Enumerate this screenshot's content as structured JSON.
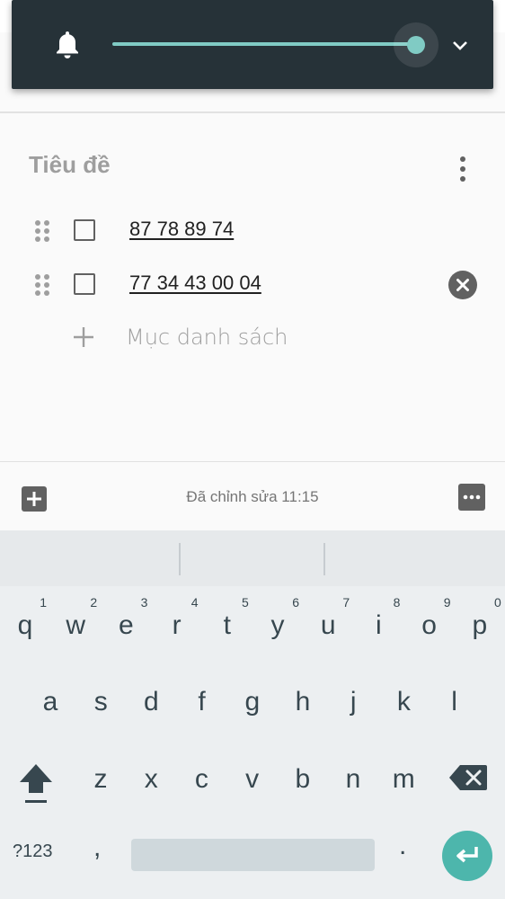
{
  "volume": {
    "level_fraction": 0.95,
    "accent": "#80cbc4",
    "panel_color": "#263238",
    "icon": "bell-icon",
    "expand_icon": "chevron-down-icon"
  },
  "note": {
    "title_placeholder": "Tiêu đề",
    "items": [
      {
        "text": "87 78 89 74",
        "checked": false
      },
      {
        "text": "77 34 43 00 04",
        "checked": false
      }
    ],
    "add_item_placeholder": "Mục danh sách"
  },
  "toolbar": {
    "status": "Đã chỉnh sửa 11:15"
  },
  "keyboard": {
    "row1": [
      {
        "k": "q",
        "h": "1"
      },
      {
        "k": "w",
        "h": "2"
      },
      {
        "k": "e",
        "h": "3"
      },
      {
        "k": "r",
        "h": "4"
      },
      {
        "k": "t",
        "h": "5"
      },
      {
        "k": "y",
        "h": "6"
      },
      {
        "k": "u",
        "h": "7"
      },
      {
        "k": "i",
        "h": "8"
      },
      {
        "k": "o",
        "h": "9"
      },
      {
        "k": "p",
        "h": "0"
      }
    ],
    "row2": [
      "a",
      "s",
      "d",
      "f",
      "g",
      "h",
      "j",
      "k",
      "l"
    ],
    "row3": [
      "z",
      "x",
      "c",
      "v",
      "b",
      "n",
      "m"
    ],
    "symbols_label": "?123",
    "comma": ",",
    "period": ".",
    "enter_color": "#4db6ac"
  }
}
